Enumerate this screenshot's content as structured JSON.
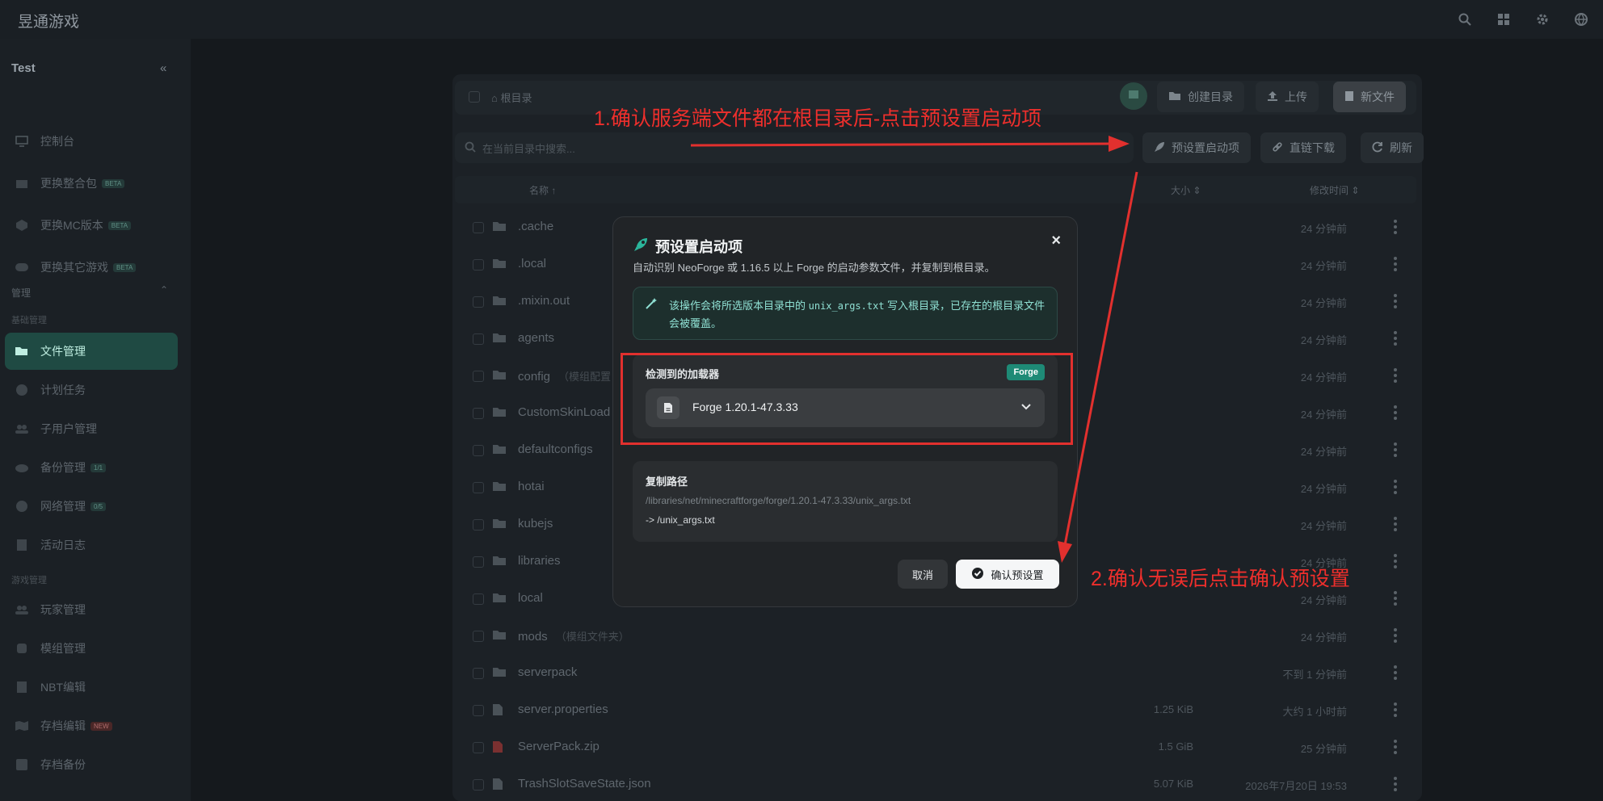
{
  "app": {
    "brand": "昱通游戏"
  },
  "sidebar": {
    "workspace": "Test",
    "items": [
      {
        "label": "控制台",
        "tag": ""
      },
      {
        "label": "更换整合包",
        "tag": "BETA"
      },
      {
        "label": "更换MC版本",
        "tag": "BETA"
      },
      {
        "label": "更换其它游戏",
        "tag": "BETA"
      }
    ],
    "section_manage": "管理",
    "sub_basic": "基础管理",
    "manage_items": [
      {
        "label": "文件管理",
        "tag": ""
      },
      {
        "label": "计划任务",
        "tag": ""
      },
      {
        "label": "子用户管理",
        "tag": ""
      },
      {
        "label": "备份管理",
        "tag": "1/1"
      },
      {
        "label": "网络管理",
        "tag": "0/5"
      },
      {
        "label": "活动日志",
        "tag": ""
      }
    ],
    "sub_game": "游戏管理",
    "game_items": [
      {
        "label": "玩家管理",
        "tag": ""
      },
      {
        "label": "模组管理",
        "tag": ""
      },
      {
        "label": "NBT编辑",
        "tag": ""
      },
      {
        "label": "存档编辑",
        "tag": "NEW"
      },
      {
        "label": "存档备份",
        "tag": ""
      }
    ]
  },
  "toolbar": {
    "breadcrumb": "根目录",
    "create_dir": "创建目录",
    "upload": "上传",
    "new_file": "新文件",
    "search_placeholder": "在当前目录中搜索...",
    "preset": "预设置启动项",
    "direct_download": "直链下载",
    "refresh": "刷新"
  },
  "table": {
    "col_name": "名称 ↑",
    "col_size": "大小 ⇕",
    "col_time": "修改时间 ⇕",
    "rows": [
      {
        "name": ".cache",
        "note": "",
        "size": "",
        "time": "24 分钟前",
        "type": "folder"
      },
      {
        "name": ".local",
        "note": "",
        "size": "",
        "time": "24 分钟前",
        "type": "folder"
      },
      {
        "name": ".mixin.out",
        "note": "",
        "size": "",
        "time": "24 分钟前",
        "type": "folder"
      },
      {
        "name": "agents",
        "note": "",
        "size": "",
        "time": "24 分钟前",
        "type": "folder"
      },
      {
        "name": "config",
        "note": "（模组配置",
        "size": "",
        "time": "24 分钟前",
        "type": "folder"
      },
      {
        "name": "CustomSkinLoad",
        "note": "",
        "size": "",
        "time": "24 分钟前",
        "type": "folder"
      },
      {
        "name": "defaultconfigs",
        "note": "",
        "size": "",
        "time": "24 分钟前",
        "type": "folder"
      },
      {
        "name": "hotai",
        "note": "",
        "size": "",
        "time": "24 分钟前",
        "type": "folder"
      },
      {
        "name": "kubejs",
        "note": "",
        "size": "",
        "time": "24 分钟前",
        "type": "folder"
      },
      {
        "name": "libraries",
        "note": "",
        "size": "",
        "time": "24 分钟前",
        "type": "folder"
      },
      {
        "name": "local",
        "note": "",
        "size": "",
        "time": "24 分钟前",
        "type": "folder"
      },
      {
        "name": "mods",
        "note": "（模组文件夹）",
        "size": "",
        "time": "24 分钟前",
        "type": "folder"
      },
      {
        "name": "serverpack",
        "note": "",
        "size": "",
        "time": "不到 1 分钟前",
        "type": "folder"
      },
      {
        "name": "server.properties",
        "note": "",
        "size": "1.25 KiB",
        "time": "大约 1 小时前",
        "type": "file"
      },
      {
        "name": "ServerPack.zip",
        "note": "",
        "size": "1.5 GiB",
        "time": "25 分钟前",
        "type": "zip"
      },
      {
        "name": "TrashSlotSaveState.json",
        "note": "",
        "size": "5.07 KiB",
        "time": "2026年7月20日 19:53",
        "type": "file"
      }
    ]
  },
  "modal": {
    "title": "预设置启动项",
    "description": "自动识别 NeoForge 或 1.16.5 以上 Forge 的启动参数文件，并复制到根目录。",
    "info_pre": "该操作会将所选版本目录中的 ",
    "info_code": "unix_args.txt",
    "info_post": " 写入根目录，已存在的根目录文件会被覆盖。",
    "loader_label": "检测到的加载器",
    "loader_badge": "Forge",
    "selected_version": "Forge 1.20.1-47.3.33",
    "copy_label": "复制路径",
    "source_path": "/libraries/net/minecraftforge/forge/1.20.1-47.3.33/unix_args.txt",
    "dest_path": "-> /unix_args.txt",
    "cancel": "取消",
    "confirm": "确认预设置"
  },
  "annotations": {
    "step1": "1.确认服务端文件都在根目录后-点击预设置启动项",
    "step2": "2.确认无误后点击确认预设置"
  },
  "colors": {
    "accent": "#1e8a76",
    "annotation_red": "#e2302e",
    "active_nav": "#1f4a43"
  }
}
